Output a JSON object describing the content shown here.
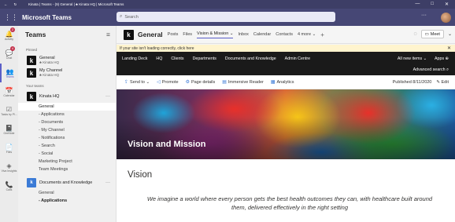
{
  "window": {
    "title": "Kinata | Teams - (9) General | ♣ Kinata HQ | Microsoft Teams",
    "back": "←",
    "refresh": "↻",
    "minimize": "—",
    "maximize": "□",
    "close": "✕"
  },
  "header": {
    "app_name": "Microsoft Teams",
    "search_placeholder": "Search",
    "more": "···"
  },
  "rail": {
    "items": [
      {
        "label": "Activity",
        "icon": "🔔",
        "badge": "2"
      },
      {
        "label": "Chat",
        "icon": "💬",
        "badge": "4"
      },
      {
        "label": "Teams",
        "icon": "👥",
        "badge": ""
      },
      {
        "label": "Calendar",
        "icon": "📅",
        "badge": ""
      },
      {
        "label": "Tasks by Pl...",
        "icon": "☑",
        "badge": ""
      },
      {
        "label": "OneNote",
        "icon": "📓",
        "badge": ""
      },
      {
        "label": "Files",
        "icon": "📄",
        "badge": ""
      },
      {
        "label": "Viva Insights",
        "icon": "◈",
        "badge": ""
      },
      {
        "label": "Calls",
        "icon": "📞",
        "badge": ""
      }
    ]
  },
  "panel": {
    "title": "Teams",
    "filter": "≡",
    "pinned_label": "Pinned",
    "pinned": [
      {
        "name": "General",
        "team": "♣ Kinata HQ"
      },
      {
        "name": "My Channel",
        "team": "♣ Kinata HQ"
      }
    ],
    "your_teams_label": "Your teams",
    "team1": {
      "logo": "k",
      "name": "Kinata HQ",
      "dots": "···",
      "channels": [
        "General",
        "- Applications",
        "- Documents",
        "- My Channel",
        "- Notifications",
        "- Search",
        "- Social",
        "Marketing Project",
        "Team Meetings"
      ]
    },
    "team2": {
      "logo": "k",
      "name": "Documents and Knowledge",
      "dots": "···",
      "channels": [
        "General",
        "- Applications"
      ]
    }
  },
  "channel": {
    "logo": "k",
    "name": "General",
    "tabs": [
      "Posts",
      "Files",
      "Vision & Mission ⌄",
      "Inbox",
      "Calendar",
      "Contacts",
      "4 more ⌄"
    ],
    "add": "+",
    "meet_label": "Meet",
    "meet_chevron": "⌄",
    "chat_icon": "◌"
  },
  "warning": {
    "text": "If your site isn't loading correctly, click here",
    "close": "✕"
  },
  "spnav": {
    "links": [
      "Landing Deck",
      "HQ",
      "Clients",
      "Departments",
      "Documents and Knowledge",
      "Admin Centre"
    ],
    "all_new": "All new items ⌄",
    "apps": "Apps ⊕",
    "advanced_search": "Advanced search ⌕"
  },
  "commandbar": {
    "send_to": "Send to ⌄",
    "promote": "Promote",
    "page_details": "Page details",
    "immersive": "Immersive Reader",
    "analytics": "Analytics",
    "published": "Published 8/11/2020",
    "edit": "✎ Edit"
  },
  "hero": {
    "title": "Vision and Mission"
  },
  "content": {
    "heading": "Vision",
    "quote": "We imagine a world where every person gets the best health outcomes they can, with healthcare built around them, delivered effectively in the right setting"
  }
}
